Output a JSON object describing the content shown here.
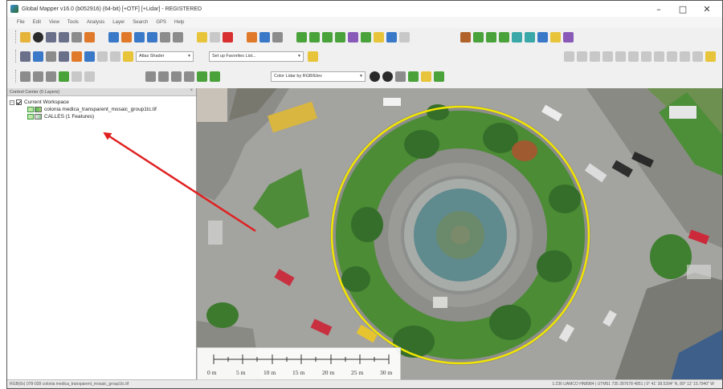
{
  "window": {
    "title": "Global Mapper v16.0 (b052916) (64-bit) [+OTF] [+Lidar] - REGISTERED",
    "minimize": "–",
    "maximize": "□",
    "close": "✕"
  },
  "menubar": {
    "items": [
      "File",
      "Edit",
      "View",
      "Tools",
      "Analysis",
      "Layer",
      "Search",
      "GPS",
      "Help"
    ]
  },
  "toolbar": {
    "shader_select": "Atlas Shader",
    "favorites_select": "Set up Favorites List...",
    "color_select": "Color Lidar by RGB/Elev"
  },
  "control_center": {
    "title": "Control Center (0 Layers)",
    "close": "×",
    "workspace_toggle": "–",
    "workspace_label": "Current Workspace",
    "layers": [
      {
        "label": "colonia medica_transparent_mosaic_group1tc.tif",
        "type": "raster"
      },
      {
        "label": "CALLES (1 Features)",
        "type": "vector"
      }
    ]
  },
  "scalebar": {
    "labels": [
      "0 m",
      "5 m",
      "10 m",
      "15 m",
      "20 m",
      "25 m",
      "30 m"
    ]
  },
  "statusbar": {
    "left": "RGB(0x) 078-028 colonia medica_transparent_mosaic_group1tc.tif",
    "right": "1:236 UAMCO HN8984 | UTM51 735 287678 4851 | 0° 41' 38.5394\" N, 89° 12' 15.7940\" W"
  },
  "colors": {
    "feature_outline": "#f2e600",
    "arrow": "#e02020",
    "vegetation": "#4a8a35",
    "pavement": "#9c9c98"
  }
}
